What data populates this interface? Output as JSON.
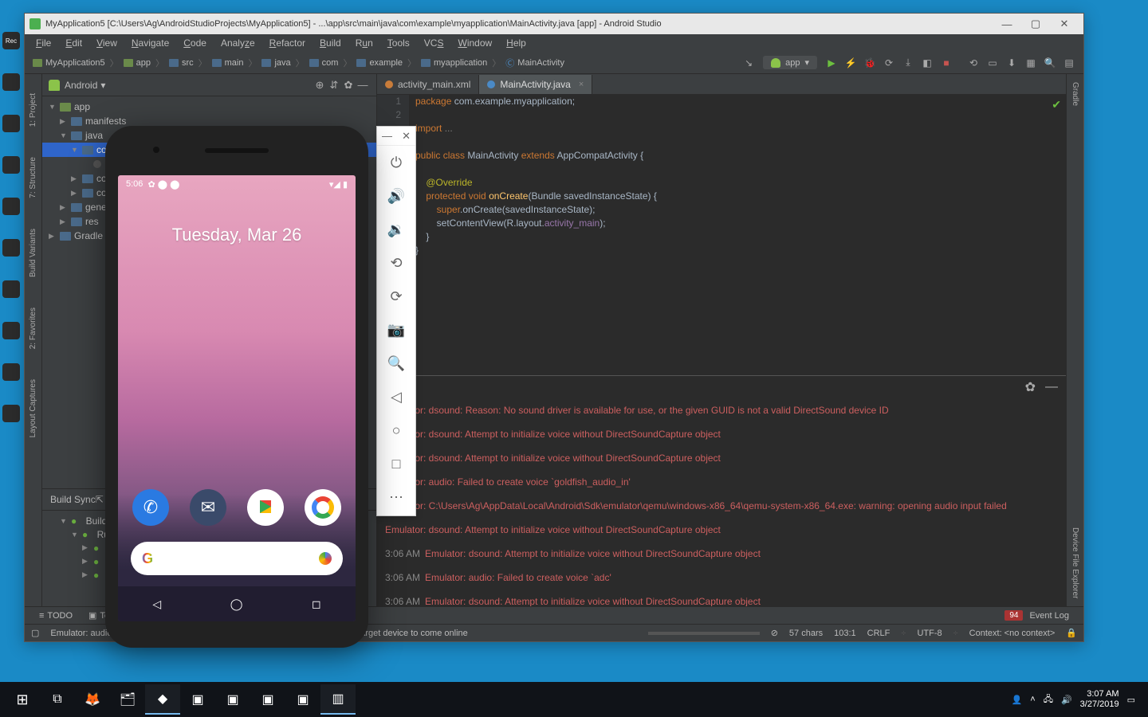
{
  "window": {
    "title": "MyApplication5 [C:\\Users\\Ag\\AndroidStudioProjects\\MyApplication5] - ...\\app\\src\\main\\java\\com\\example\\myapplication\\MainActivity.java [app] - Android Studio"
  },
  "menu": [
    "File",
    "Edit",
    "View",
    "Navigate",
    "Code",
    "Analyze",
    "Refactor",
    "Build",
    "Run",
    "Tools",
    "VCS",
    "Window",
    "Help"
  ],
  "breadcrumbs": [
    "MyApplication5",
    "app",
    "src",
    "main",
    "java",
    "com",
    "example",
    "myapplication",
    "MainActivity"
  ],
  "run_config": {
    "label": "app"
  },
  "sidebar": {
    "title": "Android",
    "items": [
      {
        "label": "app",
        "depth": 0,
        "arrow": "▼",
        "type": "mod"
      },
      {
        "label": "manifests",
        "depth": 1,
        "arrow": "▶",
        "type": "dir"
      },
      {
        "label": "java",
        "depth": 1,
        "arrow": "▼",
        "type": "dir"
      },
      {
        "label": "com",
        "depth": 2,
        "arrow": "▼",
        "type": "dir",
        "sel": true
      },
      {
        "label": "",
        "depth": 3,
        "arrow": "",
        "type": "pkg"
      },
      {
        "label": "com",
        "depth": 2,
        "arrow": "▶",
        "type": "dir"
      },
      {
        "label": "com",
        "depth": 2,
        "arrow": "▶",
        "type": "dir"
      },
      {
        "label": "generatedJava",
        "depth": 1,
        "arrow": "▶",
        "type": "dir"
      },
      {
        "label": "res",
        "depth": 1,
        "arrow": "▶",
        "type": "dir"
      },
      {
        "label": "Gradle Scripts",
        "depth": 0,
        "arrow": "▶",
        "type": "dir"
      }
    ]
  },
  "left_gutter": [
    "1: Project",
    "7: Structure",
    "Build Variants",
    "2: Favorites",
    "Layout Captures"
  ],
  "right_gutter": [
    "Gradle",
    "Device File Explorer"
  ],
  "run_tree": {
    "header": "Build   Sync",
    "items": [
      "Build: completed",
      "Run build",
      "",
      "",
      ""
    ]
  },
  "tabs": [
    {
      "label": "activity_main.xml",
      "type": "xml",
      "active": false
    },
    {
      "label": "MainActivity.java",
      "type": "java",
      "active": true
    }
  ],
  "code": {
    "line_numbers": "1\n2\n",
    "text": "package com.example.myapplication;\n\nimport ...\n\npublic class MainActivity extends AppCompatActivity {\n\n    @Override\n    protected void onCreate(Bundle savedInstanceState) {\n        super.onCreate(savedInstanceState);\n        setContentView(R.layout.activity_main);\n    }\n}"
  },
  "console": {
    "lines": [
      {
        "ts": "",
        "msg": "Emulator: dsound: Reason: No sound driver is available for use, or the given GUID is not a valid DirectSound device ID"
      },
      {
        "ts": "",
        "msg": "Emulator: dsound: Attempt to initialize voice without DirectSoundCapture object"
      },
      {
        "ts": "",
        "msg": "Emulator: dsound: Attempt to initialize voice without DirectSoundCapture object"
      },
      {
        "ts": "",
        "msg": "Emulator: audio: Failed to create voice `goldfish_audio_in'"
      },
      {
        "ts": "",
        "msg": "Emulator: C:\\Users\\Ag\\AppData\\Local\\Android\\Sdk\\emulator\\qemu\\windows-x86_64\\qemu-system-x86_64.exe: warning: opening audio input failed"
      },
      {
        "ts": "",
        "msg": "Emulator: dsound: Attempt to initialize voice without DirectSoundCapture object"
      },
      {
        "ts": "3:06 AM",
        "msg": "Emulator: dsound: Attempt to initialize voice without DirectSoundCapture object"
      },
      {
        "ts": "3:06 AM",
        "msg": "Emulator: audio: Failed to create voice `adc'"
      },
      {
        "ts": "3:06 AM",
        "msg": "Emulator: dsound: Attempt to initialize voice without DirectSoundCapture object"
      }
    ]
  },
  "bottom_bar": {
    "todo": "TODO",
    "terminal": "Terminal",
    "event_log_badge": "94",
    "event_log": "Event Log"
  },
  "statusbar": {
    "left": "Emulator: audio: ...",
    "center": "Waiting for target device to come online",
    "chars": "57 chars",
    "pos": "103:1",
    "le": "CRLF",
    "enc": "UTF-8",
    "context": "Context: <no context>"
  },
  "phone": {
    "time": "5:06",
    "date": "Tuesday, Mar 26"
  },
  "taskbar": {
    "time": "3:07 AM",
    "date": "3/27/2019"
  }
}
